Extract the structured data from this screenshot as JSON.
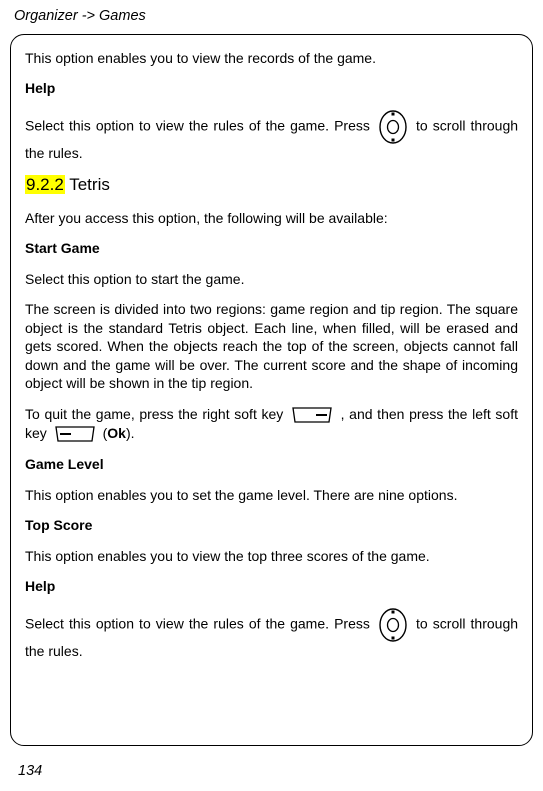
{
  "header": "Organizer -> Games",
  "pageNumber": "134",
  "body": {
    "intro": "This option enables you to view the records of the game.",
    "help1_heading": "Help",
    "help1_pre": "Select  this  option  to  view  the  rules  of  the  game.  Press",
    "help1_post": "  to  scroll through the rules.",
    "section_num": "9.2.2",
    "section_title": " Tetris",
    "after_access": "After you access this option, the following will be available:",
    "start_game_heading": "Start Game",
    "start_game_p1": "Select this option to start the game.",
    "start_game_p2": "The screen is divided into two regions: game region and tip region. The square object is the standard Tetris object. Each line, when filled, will be erased and gets scored. When the objects reach the top of the screen, objects cannot fall down and the game will be over. The current score and the shape of incoming object will be shown in the tip region.",
    "quit_pre": "  To quit the game, press the right soft key ",
    "quit_mid": ", and then press the left soft key  ",
    "quit_post": "  (",
    "quit_bold": "Ok",
    "quit_end": ").",
    "game_level_heading": "Game Level",
    "game_level_p": "This option enables you to set the game level. There are nine options.",
    "top_score_heading": "Top Score",
    "top_score_p": "This option enables you to view the top three scores of the game.",
    "help2_heading": "Help",
    "help2_pre": "Select  this  option  to  view  the  rules  of  the  game.  Press",
    "help2_post": "  to  scroll through the rules."
  }
}
